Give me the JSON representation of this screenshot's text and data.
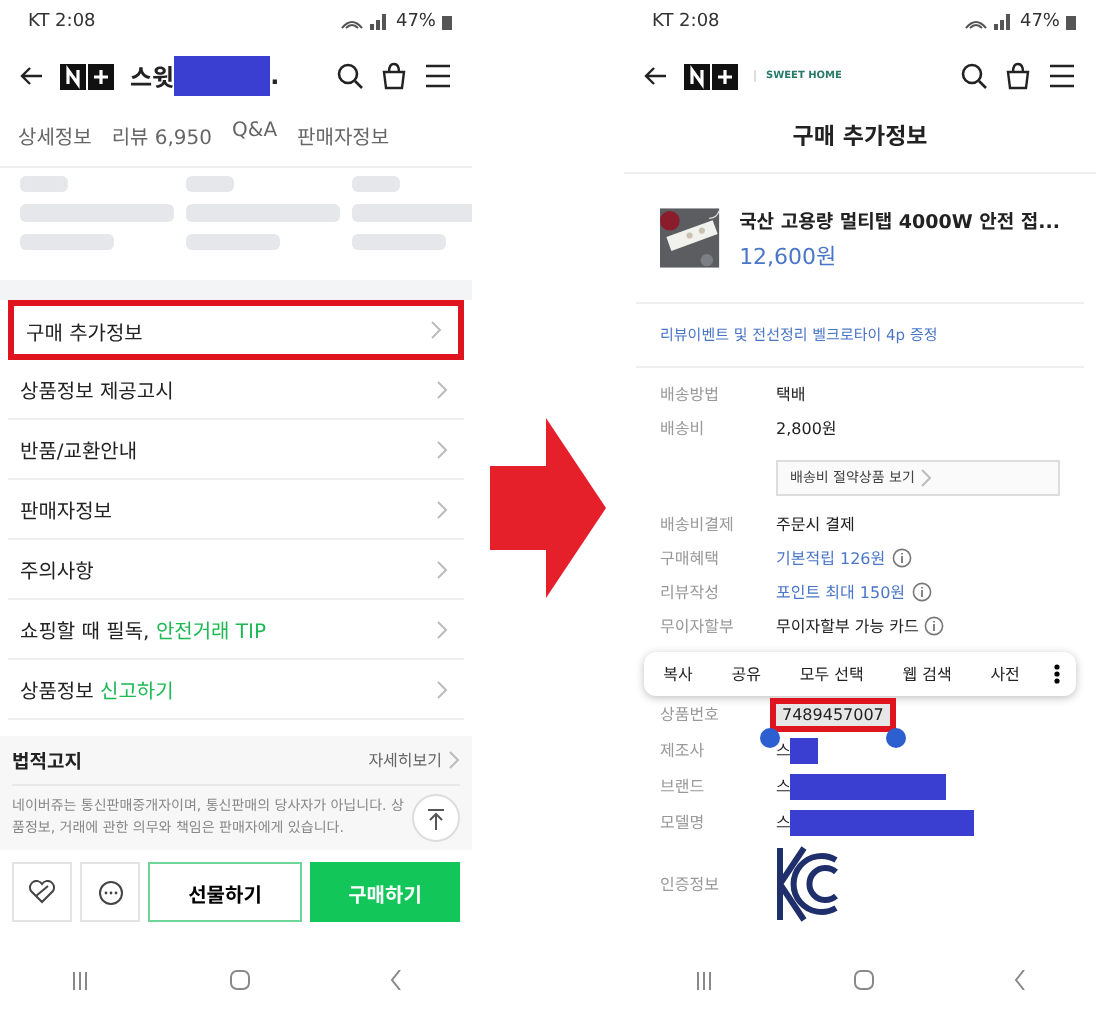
{
  "left_screen": {
    "status_bar": {
      "time": "KT 2:08",
      "battery": "47%"
    },
    "header": {
      "title": "스윗",
      "title_end": "."
    },
    "tabs": [
      {
        "label": "상세정보",
        "selected": false
      },
      {
        "label": "리뷰 6,950",
        "selected": false
      },
      {
        "label": "Q&A",
        "selected": false
      },
      {
        "label": "판매자정보",
        "selected": false
      }
    ],
    "menu_items": [
      {
        "label": "구매 추가정보",
        "highlighted": true
      },
      {
        "label": "상품정보 제공고시",
        "highlighted": false
      },
      {
        "label": "반품/교환안내",
        "highlighted": false
      },
      {
        "label": "판매자정보",
        "highlighted": false
      },
      {
        "label": "주의사항",
        "highlighted": false
      },
      {
        "label": "쇼핑할 때 필독,",
        "accent": "안전거래 TIP",
        "highlighted": false
      },
      {
        "label": "상품정보",
        "accent": "신고하기",
        "highlighted": false
      }
    ],
    "legal": {
      "title": "법적고지",
      "link": "자세히보기",
      "text": "네이버쥬는 통신판매중개자이며, 통신판매의 당사자가 아닙니다. 상품정보, 거래에 관한 의무와 책임은 판매자에게 있습니다."
    },
    "buttons": {
      "gift": "선물하기",
      "buy": "구매하기"
    }
  },
  "right_screen": {
    "status_bar": {
      "time": "KT 2:08",
      "battery": "47%"
    },
    "header": {
      "store_logo": "SWEET HOME"
    },
    "title": "구매 추가정보",
    "product": {
      "name": "국산 고용량 멀티탭 4000W 안전 접...",
      "price": "12,600원"
    },
    "promo": "리뷰이벤트 및 전선정리 벨크로타이 4p 증정",
    "details": [
      {
        "kind": "text",
        "label": "배송방법",
        "value": "택배"
      },
      {
        "kind": "text",
        "label": "배송비",
        "value": "2,800원"
      },
      {
        "kind": "button",
        "value": "배송비 절약상품 보기"
      },
      {
        "kind": "text",
        "label": "배송비결제",
        "value": "주문시 결제"
      },
      {
        "kind": "benefit",
        "label": "구매혜택",
        "value": "기본적립 126원"
      },
      {
        "kind": "benefit",
        "label": "리뷰작성",
        "value": "포인트 최대 150원"
      },
      {
        "kind": "info",
        "label": "무이자할부",
        "value": "무이자할부 가능 카드"
      }
    ],
    "context_menu": [
      "복사",
      "공유",
      "모두 선택",
      "웹 검색",
      "사전"
    ],
    "specs": [
      {
        "label": "상품번호",
        "value": "7489457007",
        "selected": true
      },
      {
        "label": "제조사",
        "value": "스"
      },
      {
        "label": "브랜드",
        "value": "스"
      },
      {
        "label": "모델명",
        "value": "스"
      },
      {
        "label": "인증정보",
        "kind": "kc_mark"
      }
    ]
  }
}
